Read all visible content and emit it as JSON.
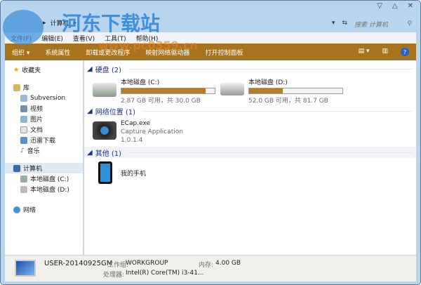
{
  "window": {
    "breadcrumb": "计算机",
    "search_placeholder": "搜索 计算机"
  },
  "menu": [
    "文件(F)",
    "编辑(E)",
    "查看(V)",
    "工具(T)",
    "帮助(H)"
  ],
  "toolbar": [
    "组织 ▾",
    "系统属性",
    "卸载或更改程序",
    "映射网络驱动器",
    "打开控制面板"
  ],
  "sidebar": {
    "favorites": "收藏夹",
    "library": "库",
    "library_items": [
      "Subversion",
      "视频",
      "图片",
      "文档",
      "迅雷下载",
      "音乐"
    ],
    "computer": "计算机",
    "drives": [
      "本地磁盘 (C:)",
      "本地磁盘 (D:)"
    ],
    "network": "网络"
  },
  "groups": {
    "disks": {
      "title": "硬盘 (2)",
      "items": [
        {
          "name": "本地磁盘 (C:)",
          "info": "2.87 GB 可用，共 30.0 GB",
          "used_pct": 90
        },
        {
          "name": "本地磁盘 (D:)",
          "info": "52.0 GB 可用，共 81.7 GB",
          "used_pct": 36
        }
      ]
    },
    "network": {
      "title": "网络位置 (1)",
      "item": {
        "name": "ECap.exe",
        "desc": "Capture Application",
        "version": "1.0.1.4"
      }
    },
    "other": {
      "title": "其他 (1)",
      "item": "我的手机"
    }
  },
  "status": {
    "computer_name": "USER-20140925GM",
    "workgroup_label": "工作组:",
    "workgroup": "WORKGROUP",
    "memory_label": "内存:",
    "memory": "4.00 GB",
    "cpu_label": "处理器:",
    "cpu": "Intel(R) Core(TM) i3-41..."
  },
  "watermark": {
    "title": "河东下载站",
    "url": "www.pc0359.cn"
  }
}
